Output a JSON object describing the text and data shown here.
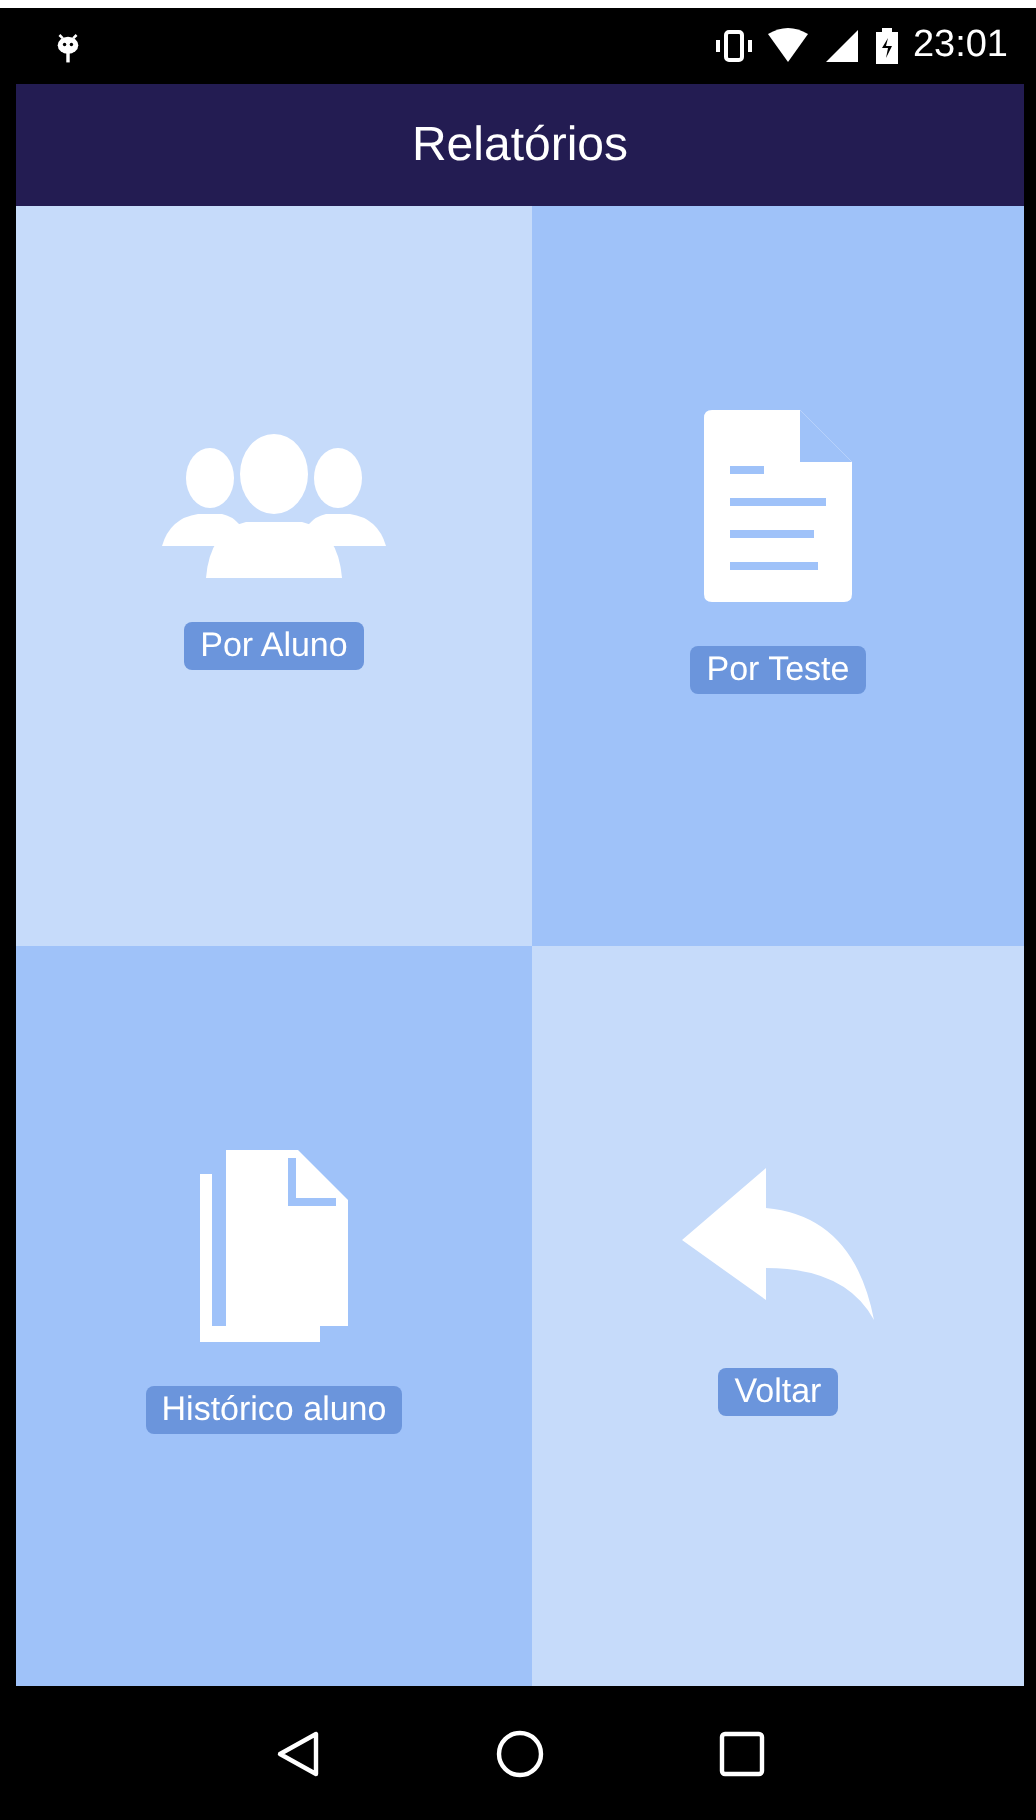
{
  "status_bar": {
    "time": "23:01"
  },
  "app_bar": {
    "title": "Relatórios"
  },
  "tiles": [
    {
      "label": "Por Aluno",
      "kind": "people",
      "color": "#c6dbfa"
    },
    {
      "label": "Por Teste",
      "kind": "document",
      "color": "#9fc2f9"
    },
    {
      "label": "Histórico aluno",
      "kind": "documents",
      "color": "#9fc2f9"
    },
    {
      "label": "Voltar",
      "kind": "reply",
      "color": "#c6dbfa"
    }
  ]
}
